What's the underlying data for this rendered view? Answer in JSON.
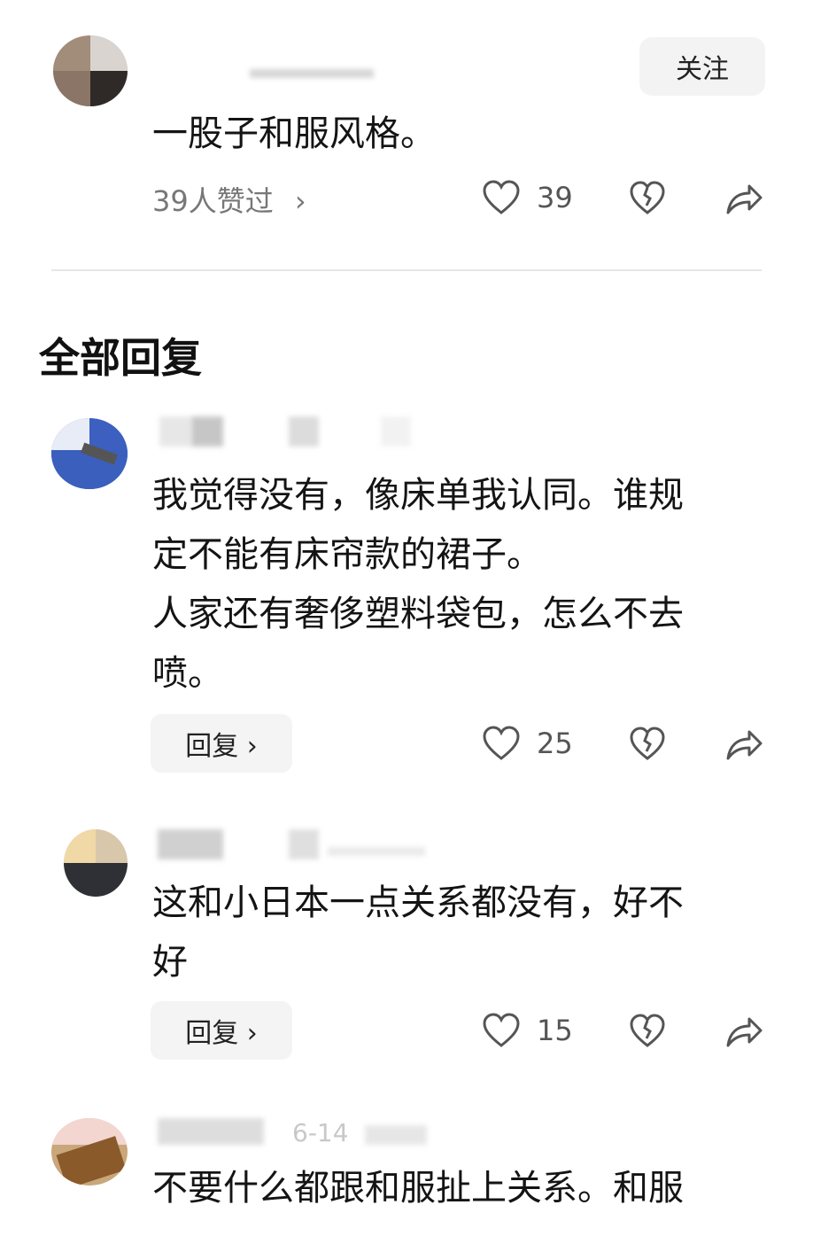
{
  "top_comment": {
    "follow_label": "关注",
    "text": "一股子和服风格。",
    "likers_label": "39人赞过",
    "likers_chevron": "›",
    "like_count": "39"
  },
  "section_title": "全部回复",
  "replies": [
    {
      "text": "我觉得没有，像床单我认同。谁规\n定不能有床帘款的裙子。\n人家还有奢侈塑料袋包，怎么不去\n喷。",
      "reply_label": "回复 ›",
      "like_count": "25"
    },
    {
      "text": "这和小日本一点关系都没有，好不\n好",
      "reply_label": "回复 ›",
      "like_count": "15"
    },
    {
      "text": "不要什么都跟和服扯上关系。和服",
      "meta_partial": "6-14"
    }
  ],
  "icons": {
    "like": "heart-outline-icon",
    "dislike": "broken-heart-icon",
    "share": "share-arrow-icon"
  }
}
